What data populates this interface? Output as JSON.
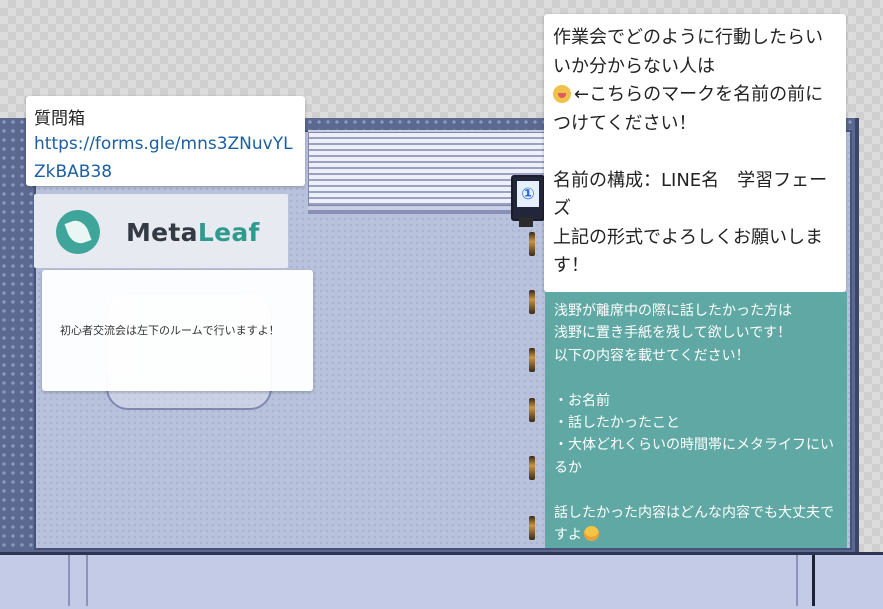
{
  "question_box": {
    "title": "質問箱",
    "link": "https://forms.gle/mns3ZNuvYLZkBAB38"
  },
  "logo": {
    "word_meta": "Meta",
    "word_leaf": "Leaf",
    "colors": {
      "brand_teal": "#2f9a8e",
      "brand_dark": "#333a44"
    },
    "icon": "leaf-icon"
  },
  "notice": {
    "text": "初心者交流会は左下のルームで行いますよ！"
  },
  "instructions": {
    "line1": "作業会でどのように行動したらいいか分からない人は",
    "line2_after_icon": "←こちらのマークを名前の前につけてください！",
    "line3": "名前の構成：LINE名　学習フェーズ",
    "line4": "上記の形式でよろしくお願いします！",
    "mark_icon": "hot-face-emoji-icon"
  },
  "message_board": {
    "line1": "浅野が離席中の際に話したかった方は",
    "line2": "浅野に置き手紙を残して欲しいです！",
    "line3": "以下の内容を載せてください！",
    "bullet1": "・お名前",
    "bullet2": "・話したかったこと",
    "bullet3": "・大体どれくらいの時間帯にメタライフにいるか",
    "closing": "話したかった内容はどんな内容でも大丈夫ですよ",
    "closing_icon": "smile-emoji-icon",
    "colors": {
      "background": "#5fa8a3",
      "text": "#ffffff"
    }
  },
  "kiosk": {
    "glyph": "①",
    "icon": "info-kiosk-icon"
  }
}
